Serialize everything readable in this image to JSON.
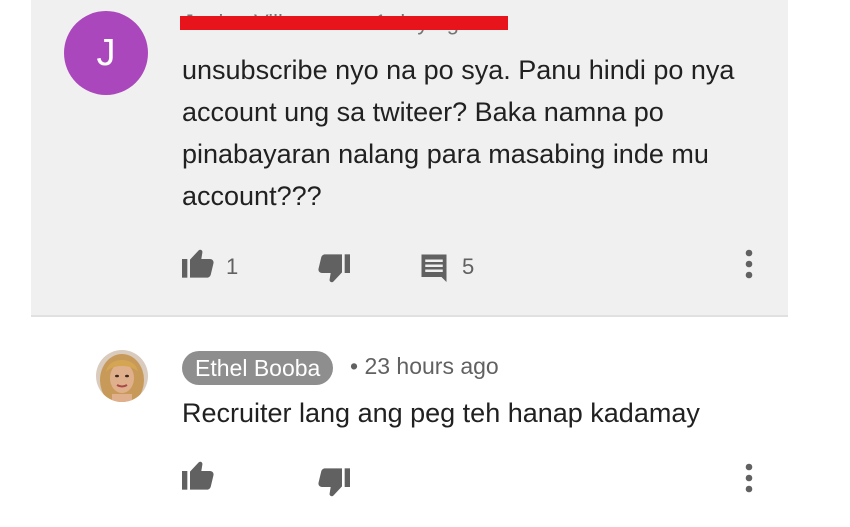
{
  "comment1": {
    "avatar_letter": "J",
    "author_line": "Janine Villanueva · 1 day ago",
    "text": "unsubscribe nyo na po sya. Panu hindi po nya account ung sa twiteer?  Baka namna po pinabayaran nalang para masabing inde mu account???",
    "likes": "1",
    "replies": "5"
  },
  "comment2": {
    "author": "Ethel Booba",
    "timestamp": "• 23 hours ago",
    "text": "Recruiter lang ang peg teh hanap kadamay"
  },
  "colors": {
    "comment1_background": "#f0f0f0",
    "avatar_j": "#ab47bc",
    "redaction": "#e8141c",
    "author_chip": "#8e8e8e",
    "icon": "#616161"
  },
  "icons": {
    "like": "thumb-up-icon",
    "dislike": "thumb-down-icon",
    "reply": "comment-icon",
    "menu": "more-vert-icon"
  }
}
